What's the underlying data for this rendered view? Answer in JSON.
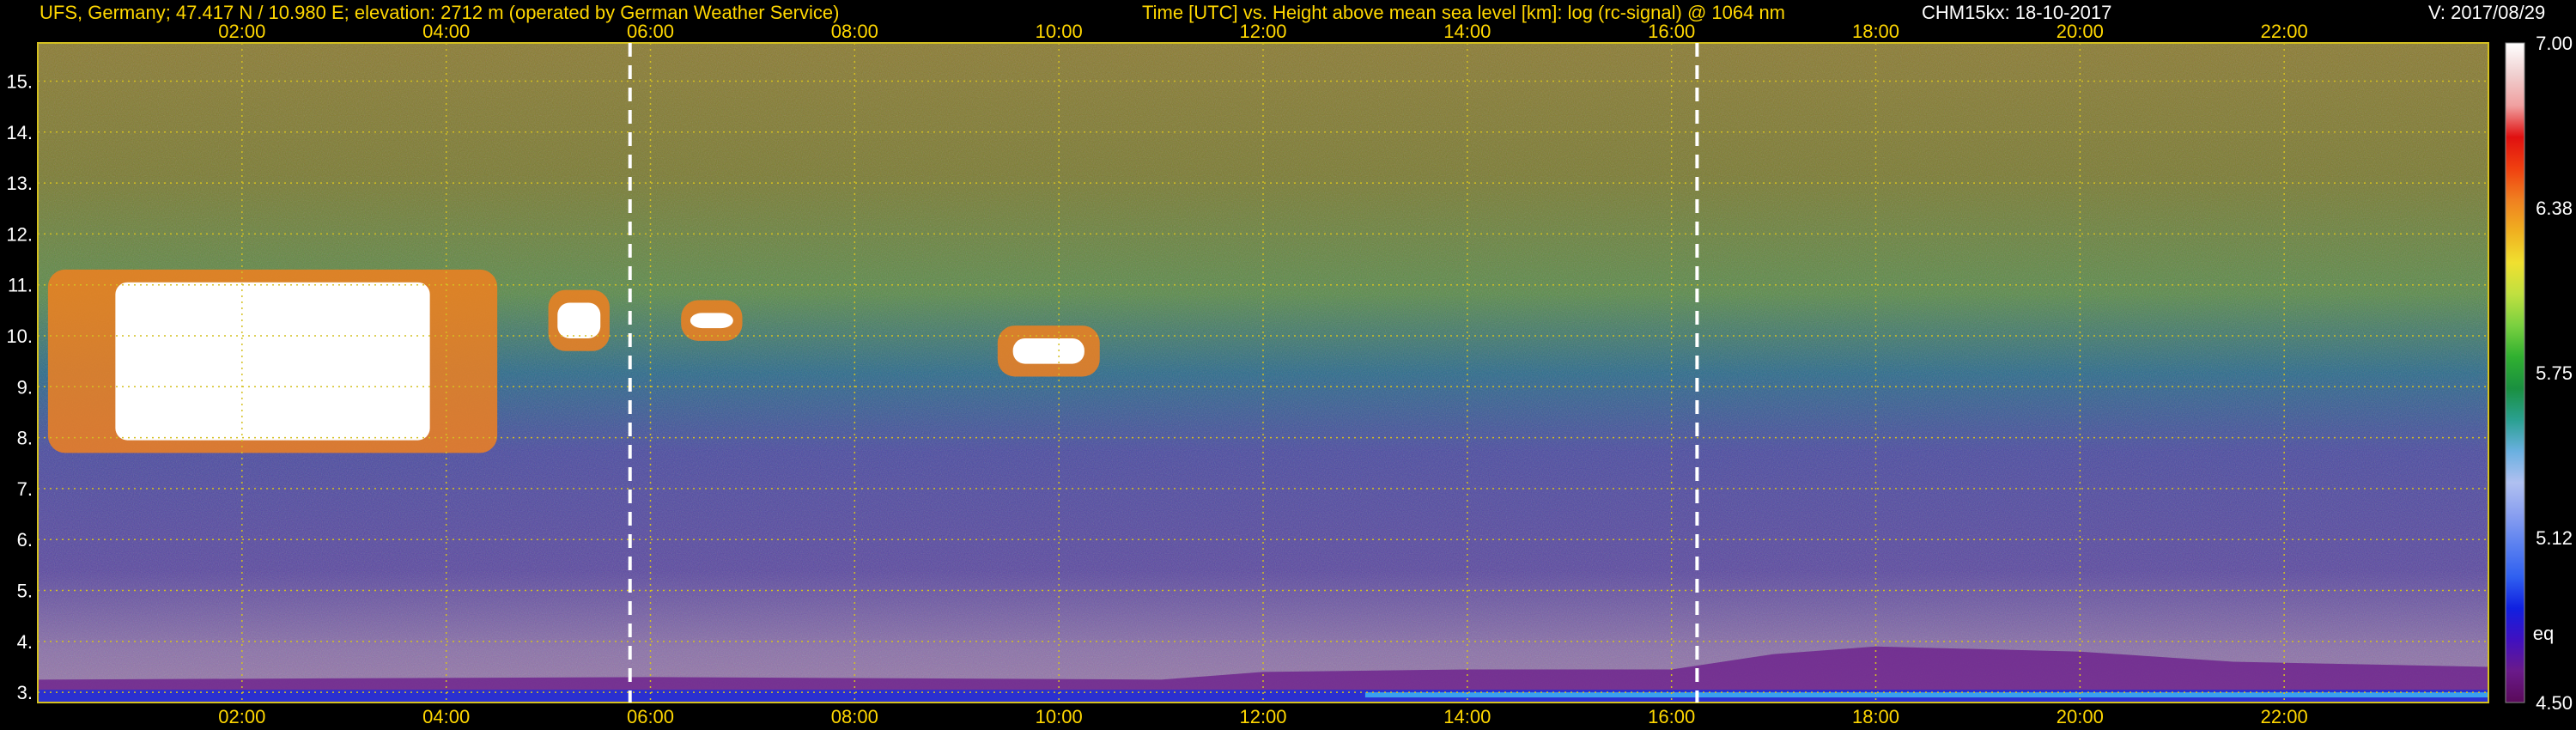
{
  "header": {
    "site": "UFS, Germany; 47.417 N / 10.980 E; elevation: 2712 m  (operated by German Weather Service)",
    "axes_desc": "Time [UTC] vs. Height above mean sea level [km]: log (rc-signal) @ 1064 nm",
    "instrument": "CHM15kx: 18-10-2017",
    "version": "V: 2017/08/29"
  },
  "chart_data": {
    "type": "heatmap",
    "title": "Time [UTC] vs. Height above mean sea level [km]: log (rc-signal) @ 1064 nm",
    "xlabel": "Time [UTC]",
    "ylabel": "Height above mean sea level [km]",
    "xlim": [
      0.0,
      24.0
    ],
    "ylim": [
      2.8,
      15.75
    ],
    "x_ticks": [
      "02:00",
      "04:00",
      "06:00",
      "08:00",
      "10:00",
      "12:00",
      "14:00",
      "16:00",
      "18:00",
      "20:00",
      "22:00"
    ],
    "x_tick_values": [
      2,
      4,
      6,
      8,
      10,
      12,
      14,
      16,
      18,
      20,
      22
    ],
    "y_ticks": [
      "3.",
      "4.",
      "5.",
      "6.",
      "7.",
      "8.",
      "9.",
      "10.",
      "11.",
      "12.",
      "13.",
      "14.",
      "15."
    ],
    "y_tick_values": [
      3,
      4,
      5,
      6,
      7,
      8,
      9,
      10,
      11,
      12,
      13,
      14,
      15
    ],
    "grid": true,
    "colorbar": {
      "min": 4.5,
      "max": 7.0,
      "tick_labels": [
        "7.00",
        "6.38",
        "5.75",
        "5.12",
        "4.50"
      ],
      "tick_values": [
        7.0,
        6.375,
        5.75,
        5.125,
        4.5
      ],
      "small_label": "eq",
      "colors": [
        "#5a0a5a",
        "#6a1a8a",
        "#4010c0",
        "#1020e0",
        "#3060f0",
        "#5a80f0",
        "#8aa0f0",
        "#b0c0f0",
        "#6ab0e0",
        "#2aa090",
        "#1a9040",
        "#30b030",
        "#7ad040",
        "#c0e040",
        "#f0e030",
        "#f0b020",
        "#f08020",
        "#f04010",
        "#e01010",
        "#f0a0a0",
        "#f0d0d0",
        "#ffffff"
      ]
    },
    "markers": [
      {
        "time": 5.8,
        "style": "dashed",
        "color": "#ffffff"
      },
      {
        "time": 16.25,
        "style": "dashed",
        "color": "#ffffff"
      }
    ],
    "cloud_layers": [
      {
        "t0": 0.1,
        "t1": 4.5,
        "h0": 7.7,
        "h1": 11.3,
        "value": 7.0
      },
      {
        "t0": 5.0,
        "t1": 5.6,
        "h0": 9.7,
        "h1": 10.9,
        "value": 7.0
      },
      {
        "t0": 6.3,
        "t1": 6.9,
        "h0": 9.9,
        "h1": 10.7,
        "value": 7.0
      },
      {
        "t0": 9.4,
        "t1": 10.4,
        "h0": 9.2,
        "h1": 10.2,
        "value": 7.0
      }
    ],
    "boundary_layer": [
      {
        "t": 0,
        "top": 3.25
      },
      {
        "t": 6,
        "top": 3.3
      },
      {
        "t": 11,
        "top": 3.25
      },
      {
        "t": 12,
        "top": 3.4
      },
      {
        "t": 14,
        "top": 3.45
      },
      {
        "t": 16,
        "top": 3.45
      },
      {
        "t": 17,
        "top": 3.75
      },
      {
        "t": 18,
        "top": 3.9
      },
      {
        "t": 20,
        "top": 3.8
      },
      {
        "t": 21.5,
        "top": 3.6
      },
      {
        "t": 24,
        "top": 3.5
      }
    ]
  }
}
